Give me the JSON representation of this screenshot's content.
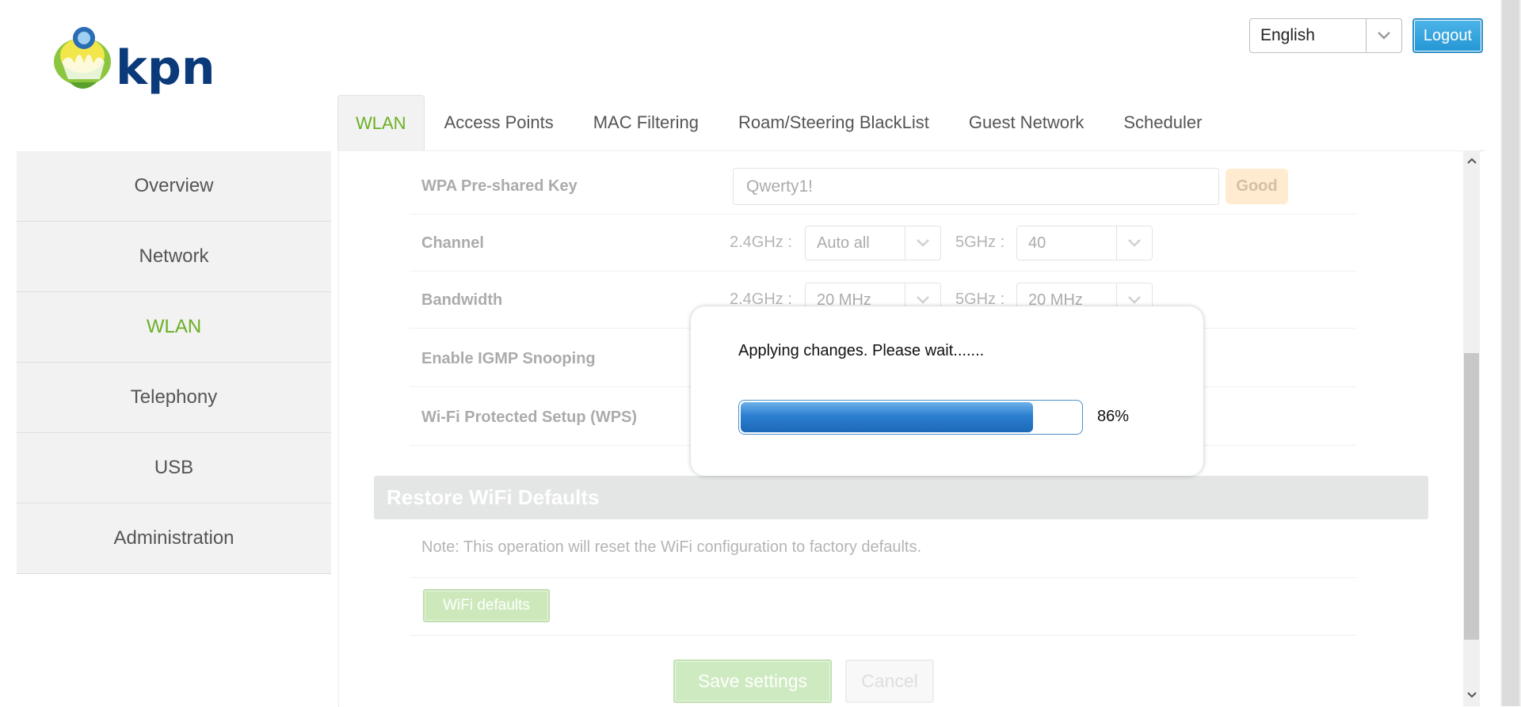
{
  "header": {
    "logo_text": "kpn",
    "language": "English",
    "logout_label": "Logout"
  },
  "tabs": [
    {
      "label": "WLAN",
      "active": true
    },
    {
      "label": "Access Points"
    },
    {
      "label": "MAC Filtering"
    },
    {
      "label": "Roam/Steering BlackList"
    },
    {
      "label": "Guest Network"
    },
    {
      "label": "Scheduler"
    }
  ],
  "sidebar": {
    "items": [
      {
        "label": "Overview"
      },
      {
        "label": "Network"
      },
      {
        "label": "WLAN",
        "active": true
      },
      {
        "label": "Telephony"
      },
      {
        "label": "USB"
      },
      {
        "label": "Administration"
      }
    ]
  },
  "form": {
    "wpa_label": "WPA Pre-shared Key",
    "wpa_value": "Qwerty1!",
    "wpa_strength": "Good",
    "channel_label": "Channel",
    "bandwidth_label": "Bandwidth",
    "igmp_label": "Enable IGMP Snooping",
    "wps_label": "Wi-Fi Protected Setup (WPS)",
    "band24_label": "2.4GHz :",
    "band5_label": "5GHz :",
    "channel_24": "Auto all",
    "channel_5": "40",
    "bandwidth_24": "20 MHz",
    "bandwidth_5": "20 MHz"
  },
  "restore": {
    "title": "Restore WiFi Defaults",
    "note": "Note: This operation will reset the WiFi configuration to factory defaults.",
    "button": "WiFi defaults"
  },
  "actions": {
    "save": "Save settings",
    "cancel": "Cancel"
  },
  "modal": {
    "message": "Applying changes. Please wait.......",
    "progress_percent": 86,
    "progress_label": "86%"
  },
  "colors": {
    "accent_green": "#6ab023",
    "logout_blue": "#2596d4",
    "progress_blue": "#2c7fd0"
  }
}
